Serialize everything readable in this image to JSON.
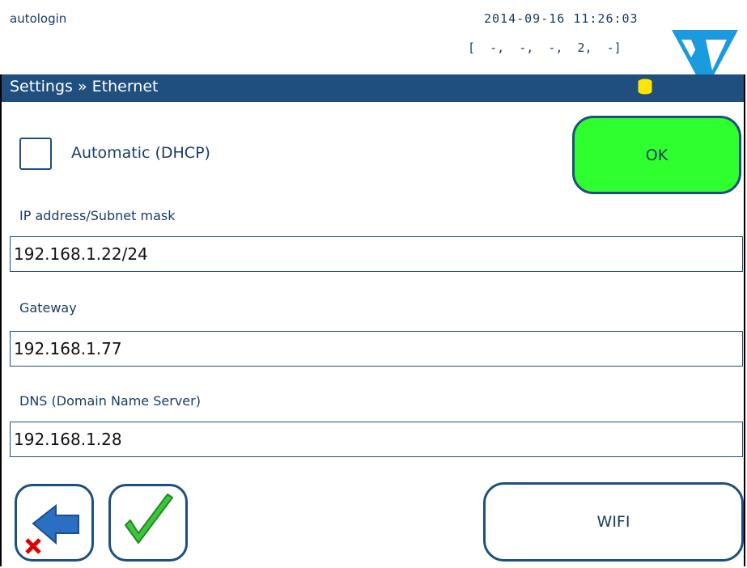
{
  "header": {
    "user": "autologin",
    "datetime": "2014-09-16 11:26:03",
    "status": "[  -,  -,  -,  2,  -]"
  },
  "titlebar": {
    "title": "Settings » Ethernet"
  },
  "dhcp": {
    "label": "Automatic (DHCP)",
    "checked": false
  },
  "ok_label": "OK",
  "fields": {
    "ip": {
      "label": "IP address/Subnet mask",
      "value": "192.168.1.22/24"
    },
    "gateway": {
      "label": "Gateway",
      "value": "192.168.1.77"
    },
    "dns": {
      "label": "DNS (Domain Name Server)",
      "value": "192.168.1.28"
    }
  },
  "buttons": {
    "wifi_label": "WIFI"
  },
  "icons": {
    "back": "back-arrow-cancel-icon",
    "confirm": "checkmark-icon",
    "database": "database-icon",
    "logo": "logo-icon"
  },
  "colors": {
    "accent": "#1e4f7e",
    "ok_green": "#2fff2f",
    "logo_blue": "#1a9be0"
  }
}
